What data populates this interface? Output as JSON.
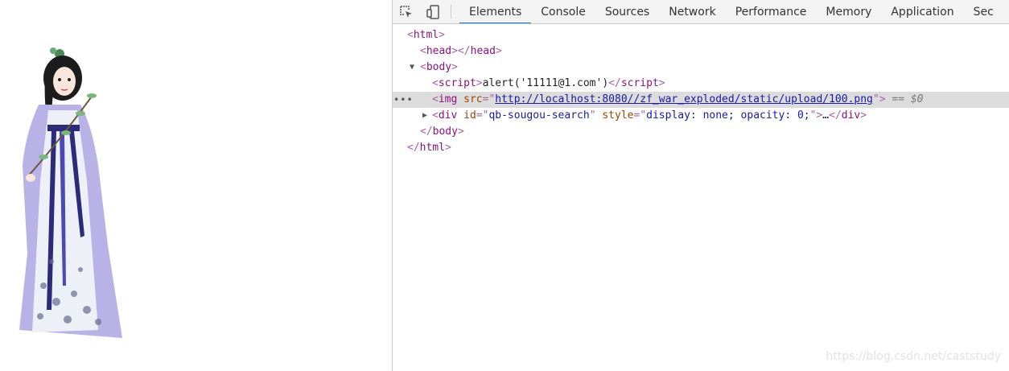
{
  "devtools": {
    "tabs": [
      {
        "label": "Elements",
        "active": true
      },
      {
        "label": "Console"
      },
      {
        "label": "Sources"
      },
      {
        "label": "Network"
      },
      {
        "label": "Performance"
      },
      {
        "label": "Memory"
      },
      {
        "label": "Application"
      },
      {
        "label": "Sec"
      }
    ],
    "accent_color": "#1a73e8"
  },
  "dom": {
    "html_open": "html",
    "head": "head",
    "body": "body",
    "script_tag": "script",
    "script_text": "alert('11111@1.com')",
    "img_tag": "img",
    "img_attr": "src",
    "img_src": "http://localhost:8080//zf_war_exploded/static/upload/100.png",
    "selected_marker": "== $0",
    "div_tag": "div",
    "div_id_attr": "id",
    "div_id": "qb-sougou-search",
    "div_style_attr": "style",
    "div_style": "display: none; opacity: 0;",
    "ellipsis": "…"
  },
  "watermark": "https://blog.csdn.net/caststudy"
}
